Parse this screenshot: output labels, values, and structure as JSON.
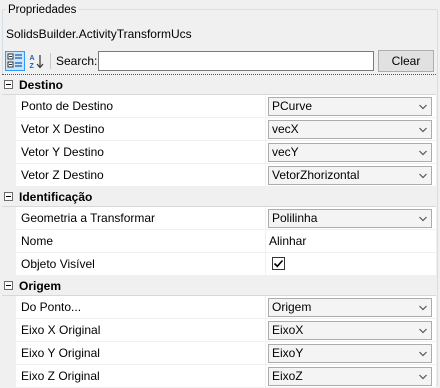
{
  "panel": {
    "group_title": "Propriedades",
    "object_name": "SolidsBuilder.ActivityTransformUcs"
  },
  "toolbar": {
    "search_label": "Search:",
    "search_value": "",
    "clear_label": "Clear",
    "categorized_active": true
  },
  "categories": [
    {
      "label": "Destino",
      "properties": [
        {
          "name": "Ponto de Destino",
          "value": "PCurve",
          "kind": "combo"
        },
        {
          "name": "Vetor X Destino",
          "value": "vecX",
          "kind": "combo"
        },
        {
          "name": "Vetor Y Destino",
          "value": "vecY",
          "kind": "combo"
        },
        {
          "name": "Vetor Z Destino",
          "value": "VetorZhorizontal",
          "kind": "combo"
        }
      ]
    },
    {
      "label": "Identificação",
      "properties": [
        {
          "name": "Geometria a Transformar",
          "value": "Polilinha",
          "kind": "combo"
        },
        {
          "name": "Nome",
          "value": "Alinhar",
          "kind": "text"
        },
        {
          "name": "Objeto Visível",
          "value": "true",
          "kind": "check"
        }
      ]
    },
    {
      "label": "Origem",
      "properties": [
        {
          "name": "Do Ponto...",
          "value": "Origem",
          "kind": "combo"
        },
        {
          "name": "Eixo X Original",
          "value": "EixoX",
          "kind": "combo"
        },
        {
          "name": "Eixo Y Original",
          "value": "EixoY",
          "kind": "combo"
        },
        {
          "name": "Eixo Z Original",
          "value": "EixoZ",
          "kind": "combo"
        }
      ]
    }
  ],
  "colors": {
    "panel_bg": "#f0f0f0",
    "selected_button": "#cce4f7",
    "selected_border": "#3399ff"
  }
}
